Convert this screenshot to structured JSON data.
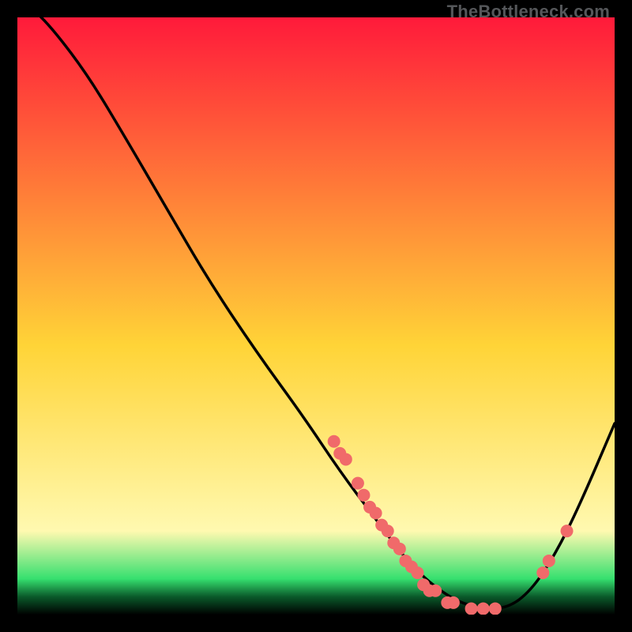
{
  "attribution": "TheBottleneck.com",
  "colors": {
    "stroke": "#000000",
    "dot": "#f06a6a",
    "gradient_top": "#ff1a3a",
    "gradient_mid": "#ffd437",
    "gradient_green": "#36e06f",
    "gradient_bottom": "#000000"
  },
  "chart_data": {
    "type": "line",
    "title": "",
    "xlabel": "",
    "ylabel": "",
    "xlim": [
      0,
      100
    ],
    "ylim": [
      0,
      100
    ],
    "curve": [
      {
        "x": 2,
        "y": 102
      },
      {
        "x": 6,
        "y": 98
      },
      {
        "x": 12,
        "y": 90
      },
      {
        "x": 18,
        "y": 80
      },
      {
        "x": 25,
        "y": 68
      },
      {
        "x": 32,
        "y": 56
      },
      {
        "x": 40,
        "y": 44
      },
      {
        "x": 48,
        "y": 33
      },
      {
        "x": 54,
        "y": 24
      },
      {
        "x": 60,
        "y": 16
      },
      {
        "x": 66,
        "y": 8
      },
      {
        "x": 72,
        "y": 3
      },
      {
        "x": 77,
        "y": 1
      },
      {
        "x": 82,
        "y": 1
      },
      {
        "x": 86,
        "y": 4
      },
      {
        "x": 90,
        "y": 10
      },
      {
        "x": 94,
        "y": 18
      },
      {
        "x": 100,
        "y": 32
      }
    ],
    "points": [
      {
        "x": 53,
        "y": 29
      },
      {
        "x": 54,
        "y": 27
      },
      {
        "x": 55,
        "y": 26
      },
      {
        "x": 57,
        "y": 22
      },
      {
        "x": 58,
        "y": 20
      },
      {
        "x": 59,
        "y": 18
      },
      {
        "x": 60,
        "y": 17
      },
      {
        "x": 61,
        "y": 15
      },
      {
        "x": 62,
        "y": 14
      },
      {
        "x": 63,
        "y": 12
      },
      {
        "x": 64,
        "y": 11
      },
      {
        "x": 65,
        "y": 9
      },
      {
        "x": 66,
        "y": 8
      },
      {
        "x": 67,
        "y": 7
      },
      {
        "x": 68,
        "y": 5
      },
      {
        "x": 69,
        "y": 4
      },
      {
        "x": 70,
        "y": 4
      },
      {
        "x": 72,
        "y": 2
      },
      {
        "x": 73,
        "y": 2
      },
      {
        "x": 76,
        "y": 1
      },
      {
        "x": 78,
        "y": 1
      },
      {
        "x": 80,
        "y": 1
      },
      {
        "x": 88,
        "y": 7
      },
      {
        "x": 89,
        "y": 9
      },
      {
        "x": 92,
        "y": 14
      }
    ]
  }
}
